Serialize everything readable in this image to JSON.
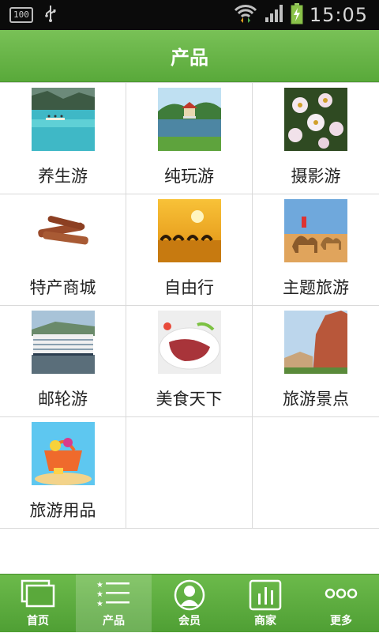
{
  "statusbar": {
    "battery_level": "100",
    "time": "15:05"
  },
  "header": {
    "title": "产品"
  },
  "products": [
    {
      "label": "养生游",
      "icon": "lake-photo"
    },
    {
      "label": "纯玩游",
      "icon": "pavilion-photo"
    },
    {
      "label": "摄影游",
      "icon": "flowers-photo"
    },
    {
      "label": "特产商城",
      "icon": "cinnamon-photo"
    },
    {
      "label": "自由行",
      "icon": "camel-sunset-photo"
    },
    {
      "label": "主题旅游",
      "icon": "camel-desert-photo"
    },
    {
      "label": "邮轮游",
      "icon": "cruise-ship-photo"
    },
    {
      "label": "美食天下",
      "icon": "food-plate-photo"
    },
    {
      "label": "旅游景点",
      "icon": "cliff-photo"
    },
    {
      "label": "旅游用品",
      "icon": "beach-bag-photo"
    }
  ],
  "bottom_nav": [
    {
      "label": "首页",
      "icon": "home-icon"
    },
    {
      "label": "产品",
      "icon": "list-icon",
      "active": true
    },
    {
      "label": "会员",
      "icon": "user-icon"
    },
    {
      "label": "商家",
      "icon": "chart-icon"
    },
    {
      "label": "更多",
      "icon": "more-icon"
    }
  ],
  "colors": {
    "brand_green": "#5eae3f",
    "grid_line": "#d9d9d9"
  }
}
